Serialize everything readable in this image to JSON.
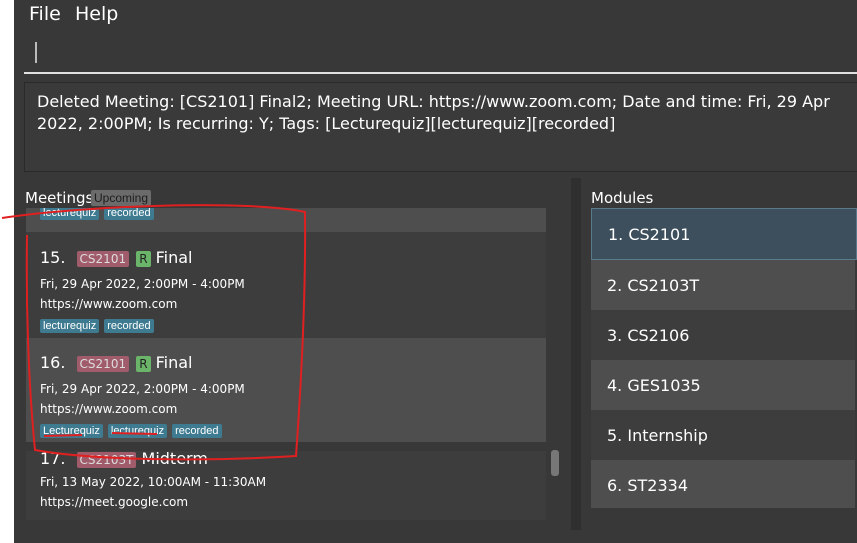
{
  "menu": {
    "file": "File",
    "help": "Help"
  },
  "command": {
    "value": ""
  },
  "result": {
    "text": "Deleted Meeting: [CS2101] Final2; Meeting URL: https://www.zoom.com; Date and time: Fri, 29 Apr 2022, 2:00PM; Is recurring: Y; Tags: [Lecturequiz][lecturequiz][recorded]"
  },
  "meetings": {
    "title": "Meetings",
    "filter_badge": "Upcoming",
    "partial_tags": [
      "lecturequiz",
      "recorded"
    ],
    "items": [
      {
        "index": "15.",
        "module": "CS2101",
        "recurring": "R",
        "name": "Final",
        "datetime": "Fri, 29 Apr 2022, 2:00PM  -  4:00PM",
        "url": "https://www.zoom.com",
        "tags": [
          "lecturequiz",
          "recorded"
        ]
      },
      {
        "index": "16.",
        "module": "CS2101",
        "recurring": "R",
        "name": "Final",
        "datetime": "Fri, 29 Apr 2022, 2:00PM  -  4:00PM",
        "url": "https://www.zoom.com",
        "tags": [
          "Lecturequiz",
          "lecturequiz",
          "recorded"
        ]
      },
      {
        "index": "17.",
        "module": "CS2103T",
        "recurring": "",
        "name": "Midterm",
        "datetime": "Fri, 13 May 2022, 10:00AM  -  11:30AM",
        "url": "https://meet.google.com",
        "tags": []
      }
    ]
  },
  "modules": {
    "title": "Modules",
    "items": [
      {
        "label": "1.  CS2101"
      },
      {
        "label": "2.  CS2103T"
      },
      {
        "label": "3.  CS2106"
      },
      {
        "label": "4.  GES1035"
      },
      {
        "label": "5.  Internship"
      },
      {
        "label": "6.  ST2334"
      }
    ]
  },
  "colors": {
    "background": "#383838",
    "module_tag": "#a05c6b",
    "recurring_tag": "#6ab56a",
    "tag": "#3e7b91",
    "selected_module": "#3d4f5c",
    "annotation": "#e02020"
  }
}
